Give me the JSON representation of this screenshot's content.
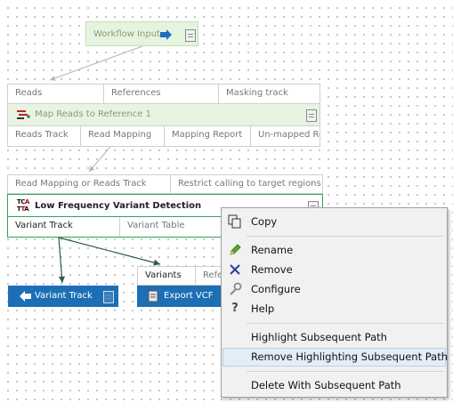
{
  "workflow_input": {
    "label": "Workflow Input"
  },
  "map_reads": {
    "title": "Map Reads to Reference 1",
    "inputs": [
      "Reads",
      "References",
      "Masking track"
    ],
    "outputs": [
      "Reads Track",
      "Read Mapping",
      "Mapping Report",
      "Un-mapped Reads"
    ]
  },
  "lfvd": {
    "title": "Low Frequency Variant Detection",
    "logo_text": "TCA TTA",
    "inputs": [
      "Read Mapping or Reads Track",
      "Restrict calling to target regions"
    ],
    "outputs": [
      "Variant Track",
      "Variant Table",
      ""
    ]
  },
  "variant_track_output": {
    "label": "Variant Track"
  },
  "export_vcf": {
    "label": "Export VCF",
    "inputs": [
      "Variants",
      "Refere"
    ]
  },
  "context_menu": {
    "copy": "Copy",
    "rename": "Rename",
    "remove": "Remove",
    "configure": "Configure",
    "help": "Help",
    "highlight": "Highlight Subsequent Path",
    "remove_highlighting": "Remove Highlighting Subsequent Path",
    "delete": "Delete With Subsequent Path"
  },
  "icons": {
    "copy": "copy-icon",
    "rename": "pencil-icon",
    "remove": "x-icon",
    "configure": "wrench-icon",
    "help": "question-icon"
  },
  "colors": {
    "input_green": "#e6f4df",
    "selected_border": "#2ea55a",
    "output_blue": "#1c6fb5",
    "menu_highlight": "#e3edf8",
    "edge": "#2f5a4a"
  }
}
